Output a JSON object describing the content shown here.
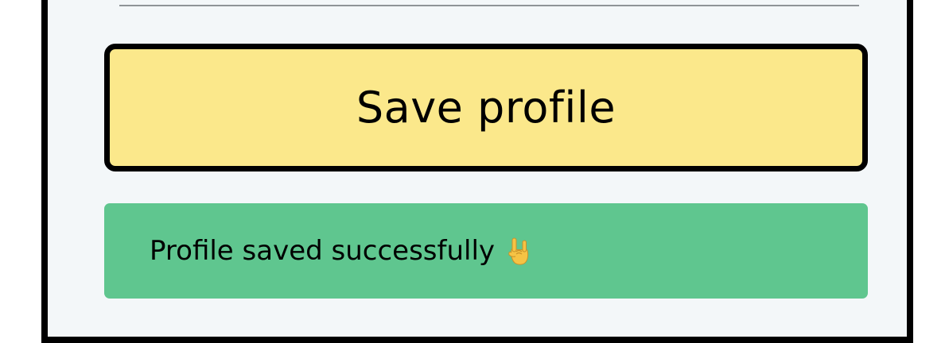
{
  "save_button": {
    "label": "Save profile",
    "background": "#fbe88b"
  },
  "toast": {
    "message": "Profile saved successfully",
    "icon": "rock-on-hand-icon",
    "background": "#5fc68f"
  }
}
